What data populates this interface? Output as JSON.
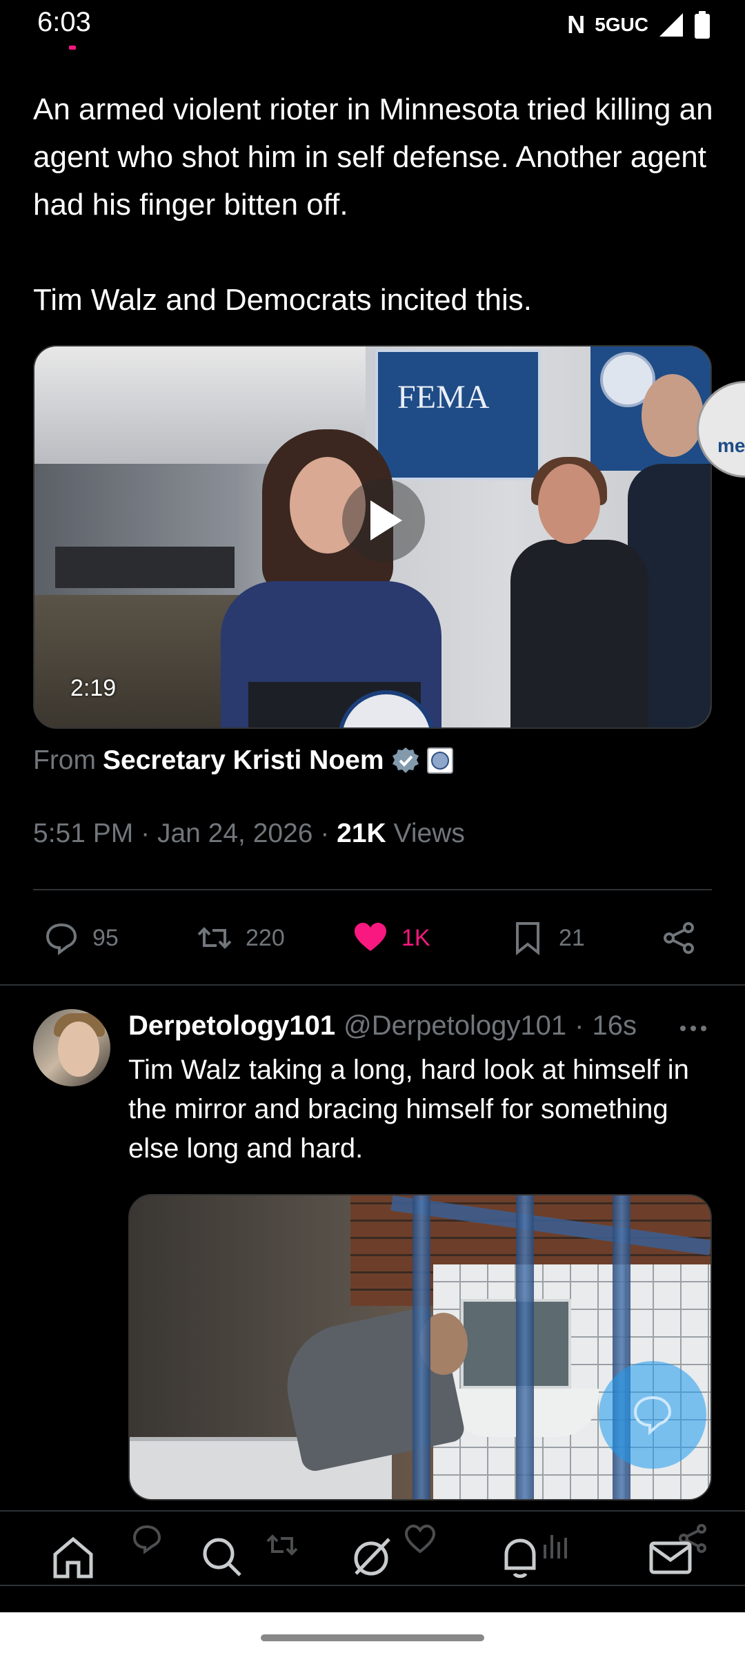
{
  "status_bar": {
    "time": "6:03",
    "nfc_glyph": "N",
    "network": "5GUC",
    "icons": [
      "nfc-icon",
      "signal-icon",
      "battery-icon"
    ]
  },
  "tweet": {
    "text": "An armed violent rioter in Minnesota tried killing an agent who shot him in self defense. Another agent had his finger bitten off.\n\nTim Walz and Democrats incited this.",
    "video": {
      "duration": "2:19",
      "sign_text": "FEMA",
      "badge_text": "me"
    },
    "from_prefix": "From",
    "from_name": "Secretary Kristi Noem",
    "time": "5:51 PM",
    "date": "Jan 24, 2026",
    "views_count": "21K",
    "views_label": "Views",
    "separator": "·",
    "stats": {
      "replies": "95",
      "reposts": "220",
      "likes": "1K",
      "bookmarks": "21"
    },
    "like_color": "#f91880"
  },
  "reply": {
    "name": "Derpetology101",
    "handle": "@Derpetology101",
    "separator": "·",
    "age": "16s",
    "text": "Tim Walz taking a long, hard look at himself in the mirror and bracing himself for something else long and hard."
  },
  "bottom_nav": {
    "items": [
      "home-icon",
      "search-icon",
      "grok-icon",
      "notifications-icon",
      "messages-icon"
    ]
  },
  "colors": {
    "background": "#000000",
    "text_primary": "#e7e9ea",
    "text_secondary": "#71767b",
    "divider": "#2f3336",
    "verified": "#829aab",
    "fab": "#1d9bf0"
  }
}
